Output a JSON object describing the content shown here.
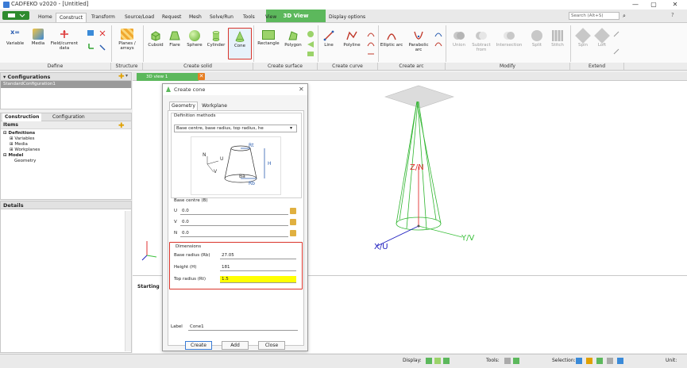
{
  "window": {
    "title": "CADFEKO v2020 - [Untitled]",
    "search_placeholder": "Search (Alt+S)",
    "minimize": "—",
    "maximize": "▢",
    "close": "✕"
  },
  "tabs": [
    "Home",
    "Construct",
    "Transform",
    "Source/Load",
    "Request",
    "Mesh",
    "Solve/Run",
    "Tools",
    "View",
    "Display options"
  ],
  "active_tab": "Construct",
  "view_tab": "3D View",
  "ribbon": {
    "define": {
      "label": "Define",
      "items": [
        "Variable",
        "Media",
        "Field/current data"
      ]
    },
    "structure": {
      "label": "Structure",
      "items": [
        "Planes / arrays"
      ]
    },
    "create_solid": {
      "label": "Create solid",
      "items": [
        "Cuboid",
        "Flare",
        "Sphere",
        "Cylinder",
        "Cone"
      ]
    },
    "create_surface": {
      "label": "Create surface",
      "items": [
        "Rectangle",
        "Polygon"
      ]
    },
    "create_curve": {
      "label": "Create curve",
      "items": [
        "Line",
        "Polyline"
      ]
    },
    "create_arc": {
      "label": "Create arc",
      "items": [
        "Elliptic arc",
        "Parabolic arc"
      ]
    },
    "modify": {
      "label": "Modify",
      "items": [
        "Union",
        "Subtract from",
        "Intersection",
        "Split",
        "Stitch"
      ]
    },
    "extend": {
      "label": "Extend",
      "items": [
        "Spin",
        "Loft"
      ]
    }
  },
  "configurations_panel": {
    "title": "Configurations",
    "item": "StandardConfiguration1"
  },
  "construction_panel": {
    "tabs": [
      "Construction",
      "Configuration"
    ],
    "items_header": "Items",
    "tree": [
      "Definitions",
      "Variables",
      "Media",
      "Workplanes",
      "Model",
      "Geometry"
    ]
  },
  "details_panel": {
    "title": "Details"
  },
  "doc_tab": "3D view 1",
  "starting_text": "Starting",
  "dialog": {
    "title": "Create cone",
    "tabs": [
      "Geometry",
      "Workplane"
    ],
    "definition_methods_label": "Definition methods",
    "definition_method_value": "Base centre, base radius, top radius, he",
    "diagram_labels": {
      "rt": "Rt",
      "h": "H",
      "rb": "Rb",
      "ba": "Ba",
      "u": "U",
      "v": "V",
      "n": "N"
    },
    "base_centre": {
      "label": "Base centre (B)",
      "rows": [
        {
          "name": "U",
          "value": "0.0"
        },
        {
          "name": "V",
          "value": "0.0"
        },
        {
          "name": "N",
          "value": "0.0"
        }
      ]
    },
    "dimensions": {
      "label": "Dimensions",
      "rows": [
        {
          "name": "Base radius (Rb)",
          "value": "27.05"
        },
        {
          "name": "Height (H)",
          "value": "181"
        },
        {
          "name": "Top radius (Rt)",
          "value": "1.5"
        }
      ]
    },
    "label_field": {
      "label": "Label",
      "value": "Cone1"
    },
    "buttons": [
      "Create",
      "Add",
      "Close"
    ]
  },
  "axes": {
    "x": "X/U",
    "y": "Y/V",
    "z": "Z/N"
  },
  "statusbar": {
    "display": "Display:",
    "tools": "Tools:",
    "selection": "Selection:",
    "unit": "Unit:"
  },
  "colors": {
    "green_accent": "#5cb85c",
    "cone_green": "#2fb52f",
    "highlight_red": "#d9342b",
    "axis_red": "#e03030",
    "axis_blue": "#2020c0",
    "axis_green": "#3cc03c",
    "yellow_field": "#ffff00"
  }
}
